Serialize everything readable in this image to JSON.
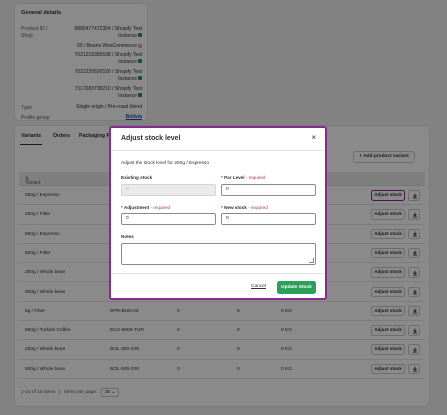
{
  "general": {
    "title": "General details",
    "product_id_label": "Product ID / Shop",
    "shop_lines": [
      "6889477472354 / Shopify Test Instance",
      "69 / Beans WooCommerce",
      "7021218365538 / Shopify Test Instance",
      "7021220626530 / Shopify Test Instance",
      "7117083738210 / Shopify Test Instance"
    ],
    "type_label": "Type",
    "type_value": "Single origin / Pre-roast blend",
    "profile_label": "Profile group",
    "profile_value": "Bolivia"
  },
  "tabs": [
    "Variants",
    "Orders",
    "Packaging Fl"
  ],
  "add_variant_label": "+ Add product variant",
  "table": {
    "headers": [
      "Variant"
    ],
    "rows": [
      {
        "variant": "250g / Espresso",
        "sku": "",
        "c1": "",
        "c2": "",
        "c3": ""
      },
      {
        "variant": "250g / Filter",
        "sku": "",
        "c1": "",
        "c2": "",
        "c3": ""
      },
      {
        "variant": "500g / Espresso",
        "sku": "",
        "c1": "",
        "c2": "",
        "c3": ""
      },
      {
        "variant": "500g / Filter",
        "sku": "",
        "c1": "",
        "c2": "",
        "c3": ""
      },
      {
        "variant": "250g / Whole bean",
        "sku": "",
        "c1": "",
        "c2": "",
        "c3": ""
      },
      {
        "variant": "500g / Whole bean",
        "sku": "",
        "c1": "",
        "c2": "",
        "c3": ""
      },
      {
        "variant": "5g / Filter",
        "sku": "SPR-BUN-24",
        "c1": "0",
        "c2": "0",
        "c3": "0 KG"
      },
      {
        "variant": "500g / Turkish Coffee",
        "sku": "ECU-5000-TUR",
        "c1": "0",
        "c2": "0",
        "c3": "0 KG"
      },
      {
        "variant": "250g / Whole bean",
        "sku": "BOL-250-GRI",
        "c1": "0",
        "c2": "0",
        "c3": "0 KG"
      },
      {
        "variant": "500g / Whole bean",
        "sku": "BOL-500-GRI",
        "c1": "0",
        "c2": "0",
        "c3": "0 KG"
      }
    ],
    "adjust_label": "Adjust stock"
  },
  "pager": {
    "range": "1-10 of 10 items",
    "per_page_label": "Items per page:",
    "per_page_value": "25"
  },
  "modal": {
    "title": "Adjust stock level",
    "close": "×",
    "description": "Adjust the stock level for 250g / Espresso",
    "existing_label": "Existing stock",
    "existing_value": "0",
    "par_label": "Par Level",
    "par_value": "0",
    "adjustment_label": "Adjustment",
    "adjustment_value": "0",
    "new_label": "New stock",
    "new_value": "0",
    "required": "- required",
    "star": "*",
    "notes_label": "Notes",
    "cancel_label": "Cancel",
    "update_label": "Update Stock"
  },
  "colors": {
    "accent": "#8a2a8f",
    "primary_button": "#2e9e5b",
    "required": "#b0393b"
  }
}
